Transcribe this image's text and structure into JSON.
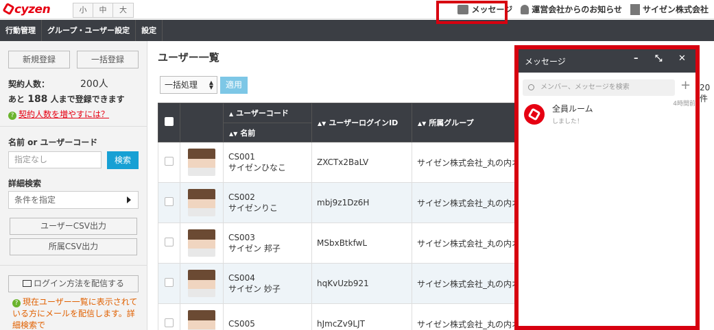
{
  "topbar": {
    "logo": "cyzen",
    "size_buttons": [
      "小",
      "中",
      "大"
    ],
    "messages": "メッセージ",
    "notices": "運営会社からのお知らせ",
    "company": "サイゼン株式会社"
  },
  "nav": [
    "行動管理",
    "グループ・ユーザー設定",
    "設定"
  ],
  "sidebar": {
    "new_register": "新規登録",
    "bulk_register": "一括登録",
    "contract_label": "契約人数：",
    "contract_value": "200人",
    "remain_pre": "あと",
    "remain_num": "188",
    "remain_post": "人まで登録できます",
    "increase_link": "契約人数を増やすには？",
    "name_label": "名前 or ユーザーコード",
    "name_placeholder": "指定なし",
    "search_button": "検索",
    "detail_label": "詳細検索",
    "condition": "条件を指定",
    "user_csv": "ユーザーCSV出力",
    "group_csv": "所属CSV出力",
    "mail_button": "ログイン方法を配信する",
    "note": "現在ユーザー一覧に表示されている方にメールを配信します。詳細検索で"
  },
  "main": {
    "title": "ユーザー一覧",
    "bulk_select": "一括処理",
    "apply": "適用",
    "cut_text": "20件",
    "columns": {
      "user_code": "ユーザーコード",
      "name": "名前",
      "login_id": "ユーザーログインID",
      "group": "所属グループ"
    },
    "rows": [
      {
        "code": "CS001",
        "name": "サイゼンひなこ",
        "login": "ZXCTx2BaLV",
        "group": "サイゼン株式会社_丸の内オフィス"
      },
      {
        "code": "CS002",
        "name": "サイゼンりこ",
        "login": "mbj9z1Dz6H",
        "group": "サイゼン株式会社_丸の内オフィス"
      },
      {
        "code": "CS003",
        "name": "サイゼン 邦子",
        "login": "MSbxBtkfwL",
        "group": "サイゼン株式会社_丸の内オフィス"
      },
      {
        "code": "CS004",
        "name": "サイゼン 妙子",
        "login": "hqKvUzb921",
        "group": "サイゼン株式会社_丸の内オフィス"
      },
      {
        "code": "CS005",
        "name": "",
        "login": "hJmcZv9LJT",
        "group": "サイゼン株式会社_丸の内オフィス"
      }
    ]
  },
  "message_panel": {
    "title": "メッセージ",
    "minimize": "–",
    "expand": "⤡",
    "close": "✕",
    "search_placeholder": "メンバー、メッセージを検索",
    "add": "+",
    "room_name": "全員ルーム",
    "room_preview": "しました！",
    "room_time": "4時間前"
  },
  "colors": {
    "brand": "#e60012",
    "nav": "#3b3e44",
    "accent": "#17a0d4",
    "highlight": "#d7000f"
  }
}
